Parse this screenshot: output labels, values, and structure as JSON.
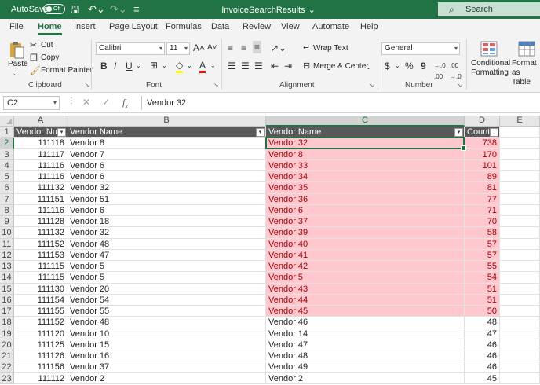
{
  "titlebar": {
    "autosave_label": "AutoSave",
    "autosave_state": "Off",
    "doc_title": "InvoiceSearchResults",
    "search_placeholder": "Search"
  },
  "tabs": [
    "File",
    "Home",
    "Insert",
    "Page Layout",
    "Formulas",
    "Data",
    "Review",
    "View",
    "Automate",
    "Help"
  ],
  "active_tab": "Home",
  "ribbon": {
    "clipboard": {
      "label": "Clipboard",
      "paste": "Paste",
      "cut": "Cut",
      "copy": "Copy",
      "format_painter": "Format Painter"
    },
    "font": {
      "label": "Font",
      "name": "Calibri",
      "size": "11",
      "bold": "B",
      "italic": "I",
      "underline": "U"
    },
    "alignment": {
      "label": "Alignment",
      "wrap_text": "Wrap Text",
      "merge_center": "Merge & Center"
    },
    "number": {
      "label": "Number",
      "format": "General",
      "currency": "$",
      "percent": "%",
      "comma": "9"
    },
    "styles": {
      "conditional_formatting": "Conditional Formatting",
      "format_as_table": "Format as Table"
    }
  },
  "formula_bar": {
    "name_box": "C2",
    "content": "Vendor 32"
  },
  "columns": [
    "A",
    "B",
    "C",
    "D",
    "E"
  ],
  "header_row": {
    "a": "Vendor Num",
    "b": "Vendor Name",
    "c": "Vendor Name",
    "d": "Counts"
  },
  "rows": [
    {
      "n": "2",
      "a": "111118",
      "b": "Vendor 8",
      "c": "Vendor 32",
      "d": "738",
      "hl": true
    },
    {
      "n": "3",
      "a": "111117",
      "b": "Vendor 7",
      "c": "Vendor 8",
      "d": "170",
      "hl": true
    },
    {
      "n": "4",
      "a": "111116",
      "b": "Vendor 6",
      "c": "Vendor 33",
      "d": "101",
      "hl": true
    },
    {
      "n": "5",
      "a": "111116",
      "b": "Vendor 6",
      "c": "Vendor 34",
      "d": "89",
      "hl": true
    },
    {
      "n": "6",
      "a": "111132",
      "b": "Vendor 32",
      "c": "Vendor 35",
      "d": "81",
      "hl": true
    },
    {
      "n": "7",
      "a": "111151",
      "b": "Vendor 51",
      "c": "Vendor 36",
      "d": "77",
      "hl": true
    },
    {
      "n": "8",
      "a": "111116",
      "b": "Vendor 6",
      "c": "Vendor 6",
      "d": "71",
      "hl": true
    },
    {
      "n": "9",
      "a": "111128",
      "b": "Vendor 18",
      "c": "Vendor 37",
      "d": "70",
      "hl": true
    },
    {
      "n": "10",
      "a": "111132",
      "b": "Vendor 32",
      "c": "Vendor 39",
      "d": "58",
      "hl": true
    },
    {
      "n": "11",
      "a": "111152",
      "b": "Vendor 48",
      "c": "Vendor 40",
      "d": "57",
      "hl": true
    },
    {
      "n": "12",
      "a": "111153",
      "b": "Vendor 47",
      "c": "Vendor 41",
      "d": "57",
      "hl": true
    },
    {
      "n": "13",
      "a": "111115",
      "b": "Vendor 5",
      "c": "Vendor 42",
      "d": "55",
      "hl": true
    },
    {
      "n": "14",
      "a": "111115",
      "b": "Vendor 5",
      "c": "Vendor 5",
      "d": "54",
      "hl": true
    },
    {
      "n": "15",
      "a": "111130",
      "b": "Vendor 20",
      "c": "Vendor 43",
      "d": "51",
      "hl": true
    },
    {
      "n": "16",
      "a": "111154",
      "b": "Vendor 54",
      "c": "Vendor 44",
      "d": "51",
      "hl": true
    },
    {
      "n": "17",
      "a": "111155",
      "b": "Vendor 55",
      "c": "Vendor 45",
      "d": "50",
      "hl": true
    },
    {
      "n": "18",
      "a": "111152",
      "b": "Vendor 48",
      "c": "Vendor 46",
      "d": "48",
      "hl": false
    },
    {
      "n": "19",
      "a": "111120",
      "b": "Vendor 10",
      "c": "Vendor 14",
      "d": "47",
      "hl": false
    },
    {
      "n": "20",
      "a": "111125",
      "b": "Vendor 15",
      "c": "Vendor 47",
      "d": "46",
      "hl": false
    },
    {
      "n": "21",
      "a": "111126",
      "b": "Vendor 16",
      "c": "Vendor 48",
      "d": "46",
      "hl": false
    },
    {
      "n": "22",
      "a": "111156",
      "b": "Vendor 37",
      "c": "Vendor 49",
      "d": "46",
      "hl": false
    },
    {
      "n": "23",
      "a": "111112",
      "b": "Vendor 2",
      "c": "Vendor 2",
      "d": "45",
      "hl": false
    }
  ],
  "colors": {
    "accent": "#217346",
    "highlight_fill": "#ffc7ce",
    "highlight_text": "#9c0006",
    "header_fill": "#595959"
  }
}
